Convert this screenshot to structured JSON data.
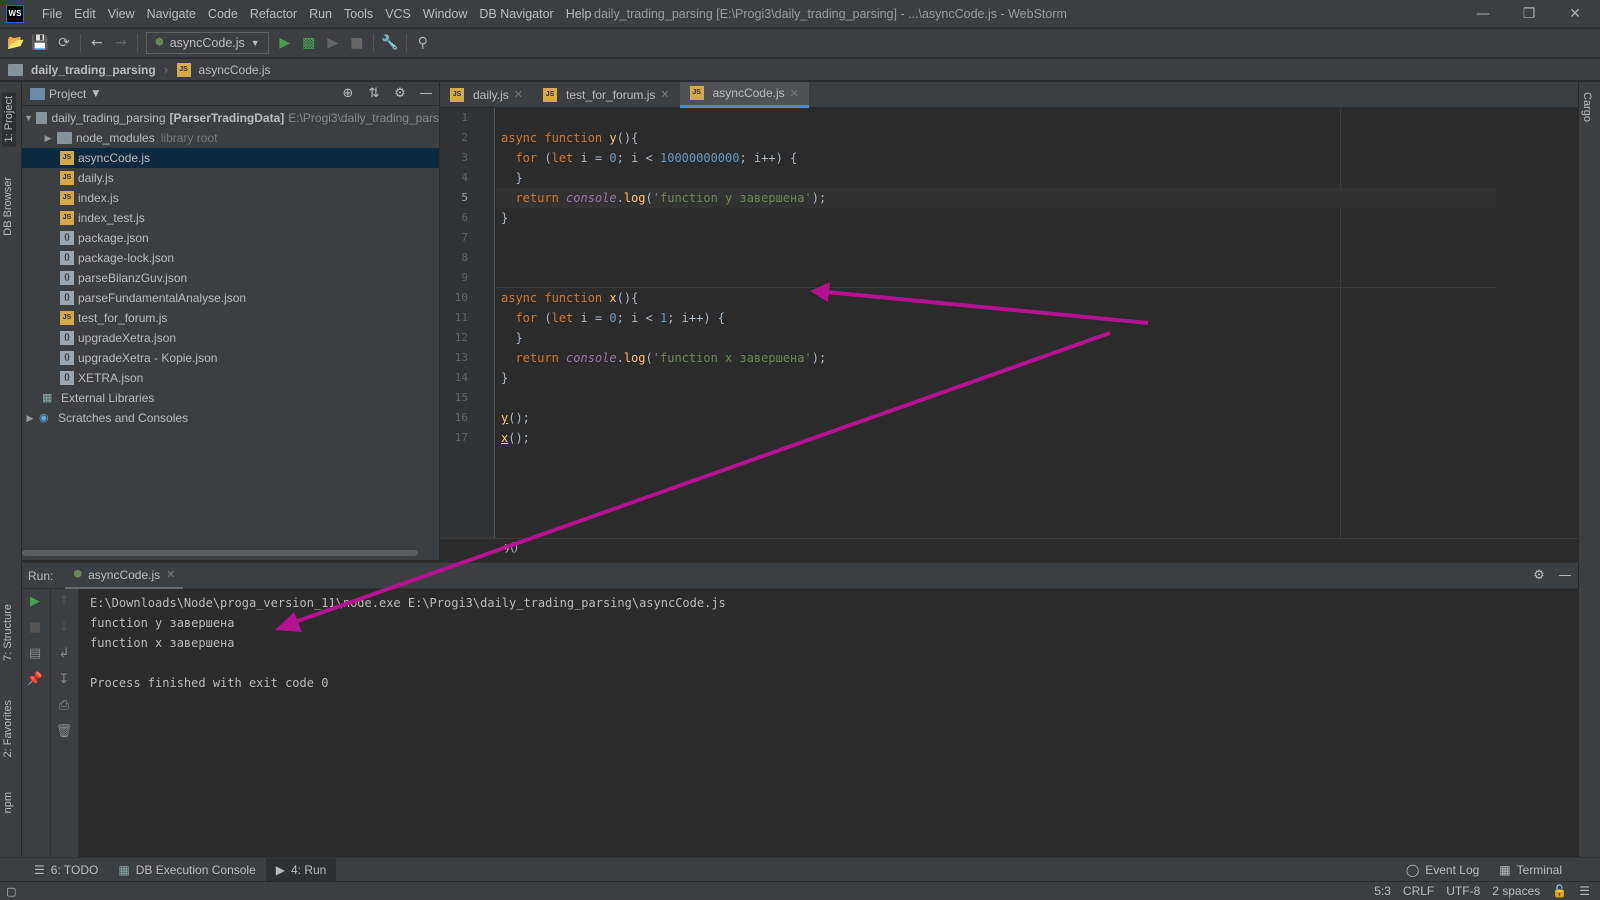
{
  "app": {
    "logo": "WS",
    "menu": [
      "File",
      "Edit",
      "View",
      "Navigate",
      "Code",
      "Refactor",
      "Run",
      "Tools",
      "VCS",
      "Window",
      "DB Navigator",
      "Help"
    ],
    "window_title": "daily_trading_parsing [E:\\Progi3\\daily_trading_parsing] - ...\\asyncCode.js - WebStorm"
  },
  "toolbar": {
    "run_config": "asyncCode.js",
    "icons": [
      "open-folder-icon",
      "save-icon",
      "sync-icon",
      "back-arrow-icon",
      "forward-arrow-icon",
      "run-icon",
      "debug-icon",
      "coverage-icon",
      "stop-icon",
      "wrench-icon",
      "search-icon"
    ]
  },
  "navbar": {
    "project": "daily_trading_parsing",
    "file": "asyncCode.js"
  },
  "left_stripe": {
    "project_tab": "1: Project",
    "db_browser_tab": "DB Browser",
    "structure_tab": "7: Structure",
    "favorites_tab": "2: Favorites",
    "npm_tab": "npm"
  },
  "right_stripe": {
    "cargo_tab": "Cargo"
  },
  "project": {
    "header": "Project",
    "root_name": "daily_trading_parsing",
    "root_module": "[ParserTradingData]",
    "root_path": "E:\\Progi3\\daily_trading_pars",
    "node_modules": "node_modules",
    "node_modules_hint": "library root",
    "files": [
      {
        "name": "asyncCode.js",
        "type": "js"
      },
      {
        "name": "daily.js",
        "type": "js"
      },
      {
        "name": "index.js",
        "type": "js"
      },
      {
        "name": "index_test.js",
        "type": "js"
      },
      {
        "name": "package.json",
        "type": "json"
      },
      {
        "name": "package-lock.json",
        "type": "json"
      },
      {
        "name": "parseBilanzGuv.json",
        "type": "json"
      },
      {
        "name": "parseFundamentalAnalyse.json",
        "type": "json"
      },
      {
        "name": "test_for_forum.js",
        "type": "js"
      },
      {
        "name": "upgradeXetra.json",
        "type": "json"
      },
      {
        "name": "upgradeXetra - Kopie.json",
        "type": "json"
      },
      {
        "name": "XETRA.json",
        "type": "json"
      }
    ],
    "external_libraries": "External Libraries",
    "scratches": "Scratches and Consoles"
  },
  "editor": {
    "tabs": [
      "daily.js",
      "test_for_forum.js",
      "asyncCode.js"
    ],
    "active_tab": "asyncCode.js",
    "line_numbers": [
      "1",
      "2",
      "3",
      "4",
      "5",
      "6",
      "7",
      "8",
      "9",
      "10",
      "11",
      "12",
      "13",
      "14",
      "15",
      "16",
      "17"
    ],
    "current_line": 5,
    "code": {
      "kw_async": "async",
      "kw_function": "function",
      "kw_for": "for",
      "kw_let": "let",
      "kw_return": "return",
      "fn_y": "y",
      "fn_x": "x",
      "console": "console",
      "log": "log",
      "limit_y": "10000000000",
      "limit_x": "1",
      "zero": "0",
      "str_y": "'function y завершена'",
      "str_x": "'function x завершена'"
    },
    "breadcrumb": "y()"
  },
  "run": {
    "label": "Run:",
    "tab": "asyncCode.js",
    "output": [
      "E:\\Downloads\\Node\\proga_version_11\\node.exe E:\\Progi3\\daily_trading_parsing\\asyncCode.js",
      "function y завершена",
      "function x завершена",
      "",
      "Process finished with exit code 0"
    ]
  },
  "bottom_tabs": {
    "todo": "6: TODO",
    "db_console": "DB Execution Console",
    "run": "4: Run",
    "event_log": "Event Log",
    "terminal": "Terminal"
  },
  "status": {
    "position": "5:3",
    "line_sep": "CRLF",
    "encoding": "UTF-8",
    "indent": "2 spaces"
  },
  "colors": {
    "annotation_arrow": "#b5128f",
    "accent": "#4a88c7"
  }
}
